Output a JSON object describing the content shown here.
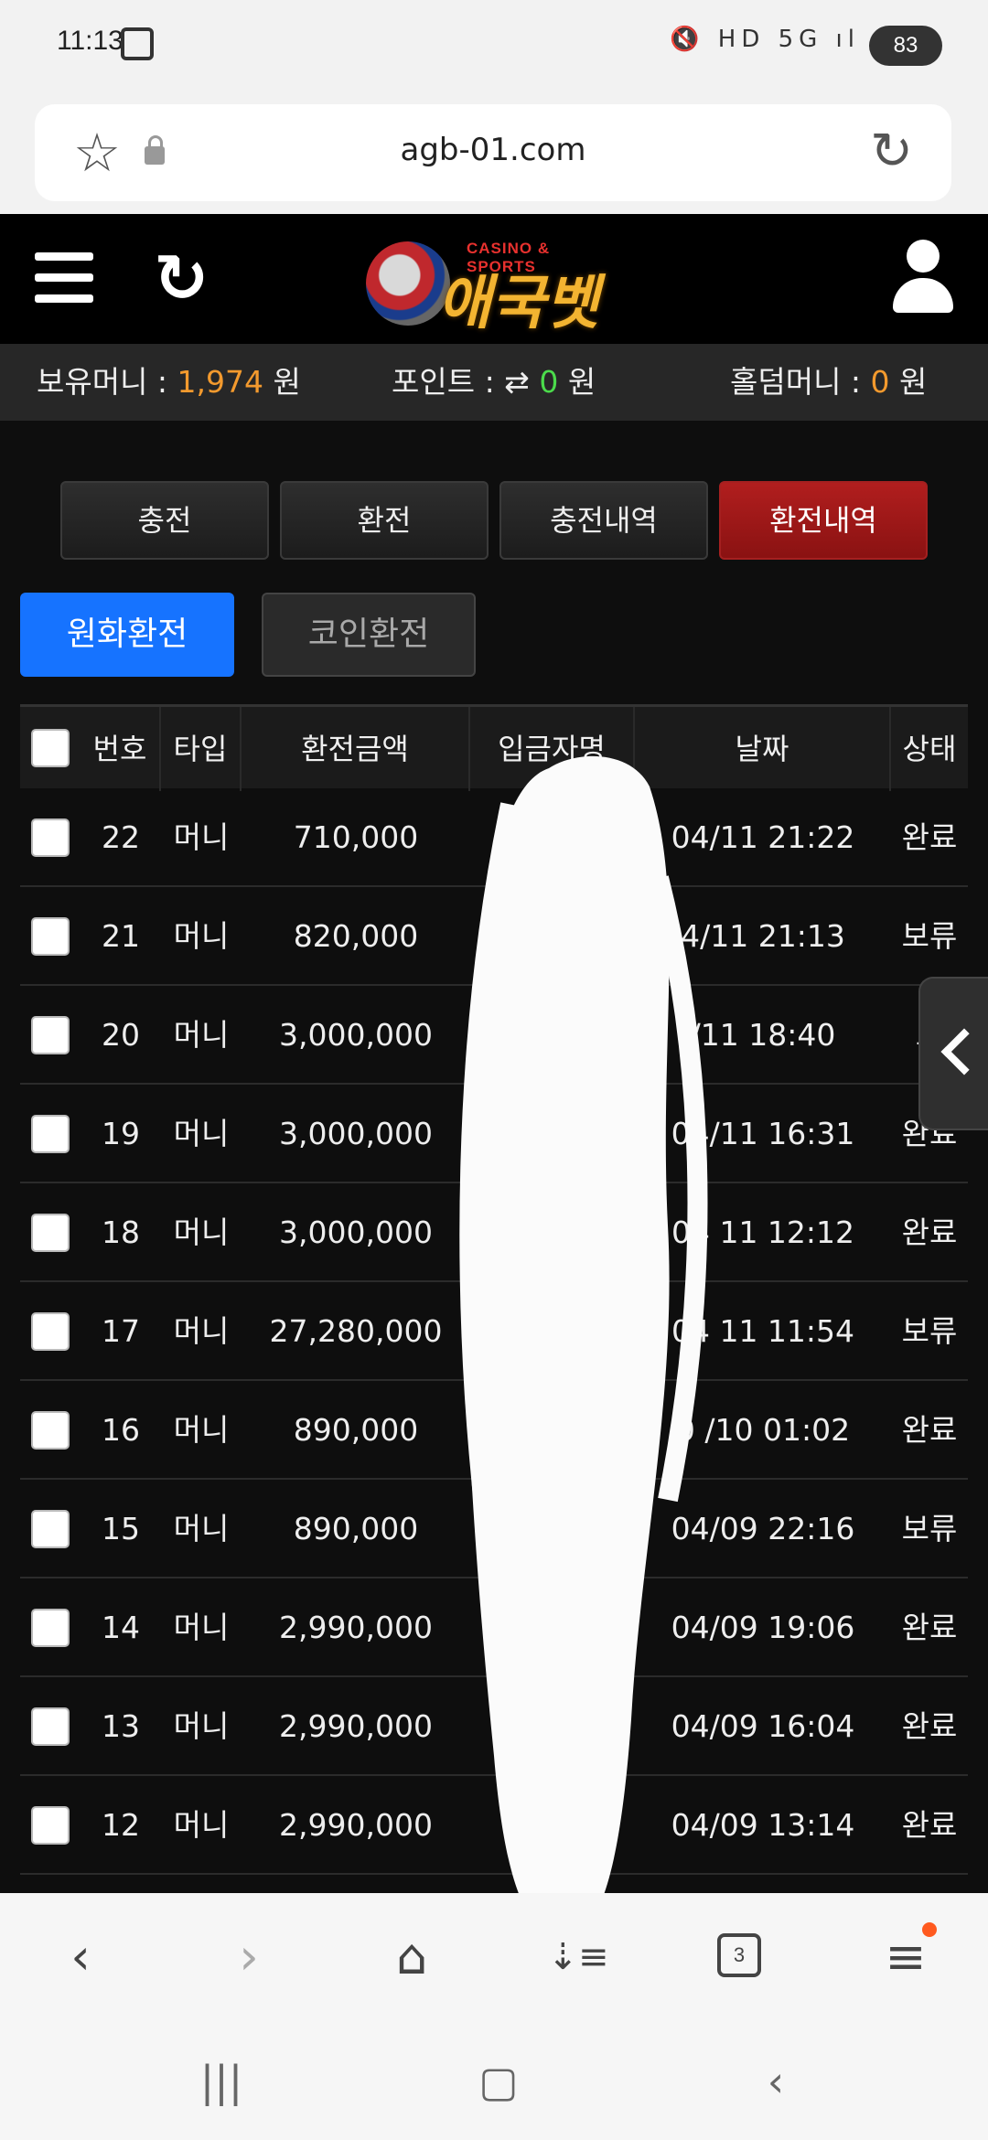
{
  "status": {
    "time": "11:13",
    "icons": "🔇 HD 5G ıl",
    "battery": "83"
  },
  "urlbar": {
    "url": "agb-01.com",
    "star_icon": "star-icon",
    "lock_icon": "lock-icon",
    "reload_icon": "reload-icon"
  },
  "header": {
    "logo_sub": "CASINO & SPORTS",
    "logo_main": "애국벳",
    "logo_badge_text": "Korea"
  },
  "balance": {
    "money_label": "보유머니 : ",
    "money_value": "1,974",
    "money_unit": " 원",
    "point_label": "포인트 : ",
    "point_icon": "⇄",
    "point_value": "0",
    "point_unit": " 원",
    "holdem_label": "홀덤머니 : ",
    "holdem_value": "0",
    "holdem_unit": " 원"
  },
  "tabs": [
    {
      "label": "충전",
      "active": false
    },
    {
      "label": "환전",
      "active": false
    },
    {
      "label": "충전내역",
      "active": false
    },
    {
      "label": "환전내역",
      "active": true
    }
  ],
  "subtabs": {
    "krw": "원화환전",
    "coin": "코인환전"
  },
  "table": {
    "headers": {
      "no": "번호",
      "type": "타입",
      "amount": "환전금액",
      "depositor": "입금자명",
      "date": "날짜",
      "status": "상태"
    },
    "rows": [
      {
        "no": "22",
        "type": "머니",
        "amount": "710,000",
        "date": "04/11 21:22",
        "status": "완료"
      },
      {
        "no": "21",
        "type": "머니",
        "amount": "820,000",
        "date": "4/11 21:13",
        "status": "보류"
      },
      {
        "no": "20",
        "type": "머니",
        "amount": "3,000,000",
        "date": "/11 18:40",
        "status": "보"
      },
      {
        "no": "19",
        "type": "머니",
        "amount": "3,000,000",
        "date": "04/11 16:31",
        "status": "완료"
      },
      {
        "no": "18",
        "type": "머니",
        "amount": "3,000,000",
        "date": "04 11 12:12",
        "status": "완료"
      },
      {
        "no": "17",
        "type": "머니",
        "amount": "27,280,000",
        "date": "04 11 11:54",
        "status": "보류"
      },
      {
        "no": "16",
        "type": "머니",
        "amount": "890,000",
        "date": "0 /10 01:02",
        "status": "완료"
      },
      {
        "no": "15",
        "type": "머니",
        "amount": "890,000",
        "date": "04/09 22:16",
        "status": "보류"
      },
      {
        "no": "14",
        "type": "머니",
        "amount": "2,990,000",
        "date": "04/09 19:06",
        "status": "완료"
      },
      {
        "no": "13",
        "type": "머니",
        "amount": "2,990,000",
        "date": "04/09 16:04",
        "status": "완료"
      },
      {
        "no": "12",
        "type": "머니",
        "amount": "2,990,000",
        "date": "04/09 13:14",
        "status": "완료"
      }
    ]
  },
  "browser": {
    "tab_count": "3"
  },
  "colors": {
    "accent_red": "#a31a1a",
    "accent_blue": "#1673ff",
    "money_orange": "#f39a2e",
    "point_green": "#4bdb4b"
  }
}
